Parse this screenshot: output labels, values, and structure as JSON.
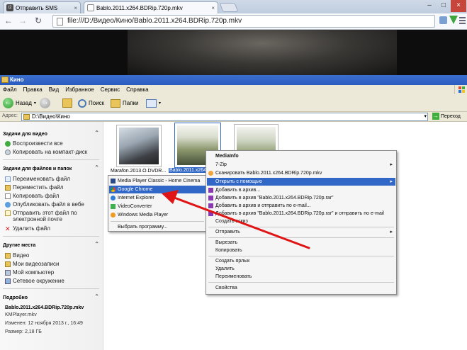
{
  "browser": {
    "tabs": [
      {
        "label": "Отправить SMS",
        "icon": "t2-logo-icon",
        "close": "×"
      },
      {
        "label": "Bablo.2011.x264.BDRip.720p.mkv",
        "icon": "file-icon",
        "close": "×"
      }
    ],
    "window_buttons": [
      "–",
      "□",
      "×"
    ],
    "address": "file:///D:/Видео/Кино/Bablo.2011.x264.BDRip.720p.mkv",
    "nav": {
      "back": "←",
      "forward": "→",
      "reload": "↻"
    }
  },
  "explorer": {
    "title": "Кино",
    "menu": [
      "Файл",
      "Правка",
      "Вид",
      "Избранное",
      "Сервис",
      "Справка"
    ],
    "toolbar": {
      "back": "Назад",
      "search": "Поиск",
      "folders": "Папки"
    },
    "address_label": "Адрес:",
    "address_value": "D:\\Видео\\Кино",
    "go_label": "Переход",
    "left_panel": {
      "video_tasks": {
        "title": "Задачи для видео",
        "collapse": "⌃",
        "items": [
          "Воспроизвести все",
          "Копировать на компакт-диск"
        ]
      },
      "file_tasks": {
        "title": "Задачи для файлов и папок",
        "collapse": "⌃",
        "items": [
          "Переименовать файл",
          "Переместить файл",
          "Копировать файл",
          "Опубликовать файл в вебе",
          "Отправить этот файл по электронной почте",
          "Удалить файл"
        ]
      },
      "other_places": {
        "title": "Другие места",
        "collapse": "⌃",
        "items": [
          "Видео",
          "Мои видеозаписи",
          "Мой компьютер",
          "Сетевое окружение"
        ]
      },
      "details": {
        "title": "Подробно",
        "collapse": "⌃",
        "filename": "Bablo.2011.x264.BDRip.720p.mkv",
        "type": "KMPlayer.mkv",
        "modified": "Изменен: 12 ноября 2013 г., 16:49",
        "size": "Размер: 2,18 ГБ"
      }
    },
    "files": [
      {
        "label": "Marafon.2013.O.DVDR..."
      },
      {
        "label": "Bablo.2011.x264.BDRip..."
      },
      {
        "label": ""
      }
    ]
  },
  "open_with_menu": {
    "items": [
      {
        "label": "Media Player Classic - Home Cinema",
        "icon": "mpc-icon"
      },
      {
        "label": "Google Chrome",
        "icon": "chrome-icon",
        "highlighted": true
      },
      {
        "label": "Internet Explorer",
        "icon": "ie-icon"
      },
      {
        "label": "VideoConverter",
        "icon": "videoconverter-icon"
      },
      {
        "label": "Windows Media Player",
        "icon": "wmp-icon"
      }
    ],
    "choose": "Выбрать программу..."
  },
  "context_menu": {
    "mediainfo": "MediaInfo",
    "zip": "7-Zip",
    "scan": "Сканировать Bablo.2011.x264.BDRip.720p.mkv",
    "open_with": "Открыть с помощью",
    "add_archive": "Добавить в архив...",
    "add_rar": "Добавить в архив \"Bablo.2011.x264.BDRip.720p.rar\"",
    "add_email": "Добавить в архив и отправить по e-mail...",
    "add_rar_email": "Добавить в архив \"Bablo.2011.x264.BDRip.720p.rar\" и отправить по e-mail",
    "sketch": "Создать эскиз",
    "send": "Отправить",
    "cut": "Вырезать",
    "copy": "Копировать",
    "shortcut": "Создать ярлык",
    "delete": "Удалить",
    "rename": "Переименовать",
    "properties": "Свойства",
    "submenu_arrow": "▸"
  },
  "colors": {
    "highlight": "#3167c6",
    "annotation_arrow": "#e01414",
    "xp_title": "#2a5bbf"
  }
}
